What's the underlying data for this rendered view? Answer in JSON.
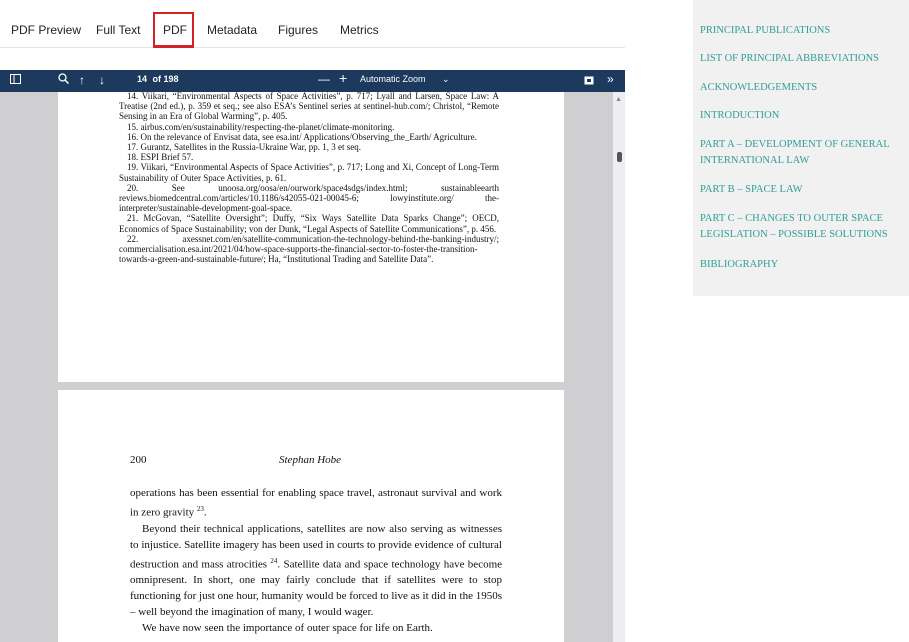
{
  "tabs": [
    {
      "label": "PDF Preview"
    },
    {
      "label": "Full Text"
    },
    {
      "label": "PDF"
    },
    {
      "label": "Metadata"
    },
    {
      "label": "Figures"
    },
    {
      "label": "Metrics"
    }
  ],
  "active_tab": "PDF",
  "viewer": {
    "page_current": "14",
    "page_total": "of 198",
    "zoom": "Automatic Zoom",
    "page1_footnotes": [
      "14. Viikari, “Environmental Aspects of Space Activities”, p. 717; Lyall and Larsen, Space Law: A Treatise (2nd ed.), p. 359 et seq.; see also ESA’s Sentinel series at sentinel-hub.com/; Christol, “Remote Sensing in an Era of Global Warming”, p. 405.",
      "15. airbus.com/en/sustainability/respecting-the-planet/climate-monitoring.",
      "16. On the relevance of Envisat data, see esa.int/ Applications/Observing_the_Earth/ Agriculture.",
      "17. Gurantz, Satellites in the Russia-Ukraine War, pp. 1, 3 et seq.",
      "18. ESPI Brief 57.",
      "19. Viikari, “Environmental Aspects of Space Activities”, p. 717; Long and Xi, Concept of Long-Term Sustainability of Outer Space Activities, p. 61.",
      "20. See unoosa.org/oosa/en/ourwork/space4sdgs/index.html; sustainableearth reviews.biomedcentral.com/articles/10.1186/s42055-021-00045-6; lowyinstitute.org/ the-interpreter/sustainable-development-goal-space.",
      "21. McGovan, “Satellite Oversight”; Duffy, “Six Ways Satellite Data Sparks Change”; OECD, Economics of Space Sustainability; von der Dunk, “Legal Aspects of Satellite Communications”, p. 456.",
      "22. axessnet.com/en/satellite-communication-the-technology-behind-the-banking-industry/; commercialisation.esa.int/2021/04/how-space-supports-the-financial-sector-to-foster-the-transition-towards-a-green-and-sustainable-future/; Ha, “Institutional Trading and Satellite Data”."
    ],
    "page2_number": "200",
    "page2_author": "Stephan Hobe",
    "page2_para1": "operations has been essential for enabling space travel, astronaut survival and work in zero gravity",
    "page2_para1_sup": "23",
    "page2_para2a": "Beyond their technical applications, satellites are now also serving as witnesses to injustice. Satellite imagery has been used in courts to provide evidence of cultural destruction and mass atrocities",
    "page2_para2_sup": "24",
    "page2_para2b": ". Satellite data and space technology have become omnipresent. In short, one may fairly conclude that if satellites were to stop functioning for just one hour, humanity would be forced to live as it did in the 1950s – well beyond the imagination of many, I would wager.",
    "page2_para3": "We have now seen the importance of outer space for life on Earth."
  },
  "rightnav": {
    "items": [
      {
        "label": "PRINCIPAL PUBLICATIONS"
      },
      {
        "label": "LIST OF PRINCIPAL ABBREVIATIONS"
      },
      {
        "label": "ACKNOWLEDGEMENTS"
      },
      {
        "label": "INTRODUCTION"
      },
      {
        "label": "PART A – DEVELOPMENT OF GENERAL INTERNATIONAL LAW"
      },
      {
        "label": "PART B – SPACE LAW"
      },
      {
        "label": "PART C – CHANGES TO OUTER SPACE LEGISLATION – POSSIBLE SOLUTIONS"
      },
      {
        "label": "BIBLIOGRAPHY"
      }
    ]
  },
  "colors": {
    "toolbar": "#1d3a5e",
    "active_tab_border": "#d32424",
    "nav_link": "#2f9e96"
  }
}
